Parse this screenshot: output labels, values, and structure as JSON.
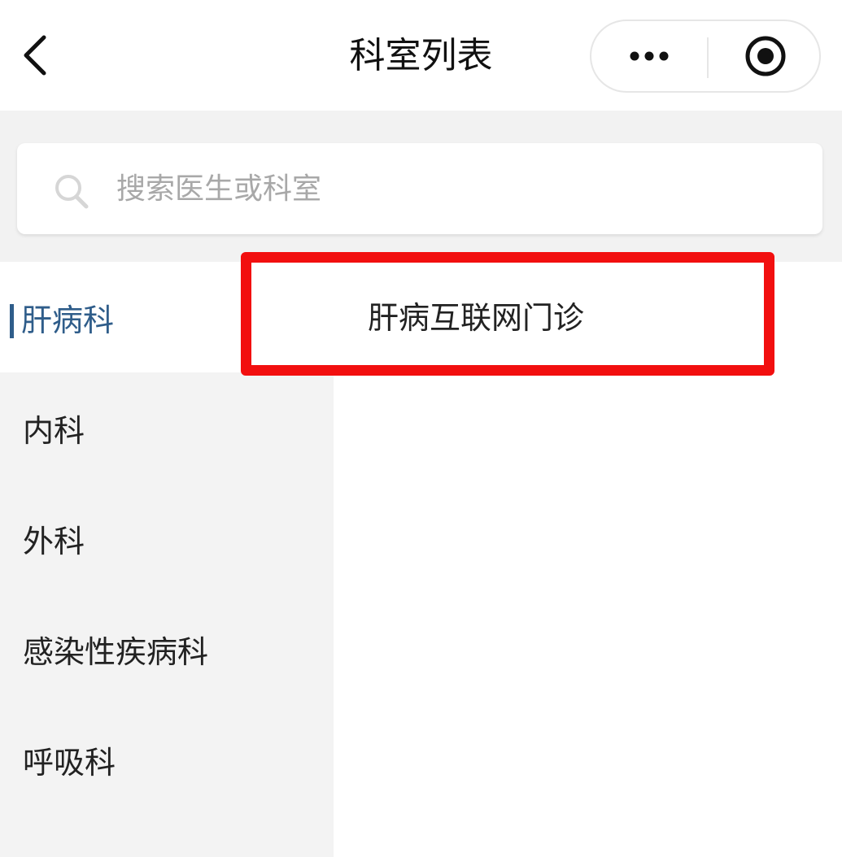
{
  "header": {
    "title": "科室列表",
    "back_icon": "chevron-left-icon",
    "more_icon": "more-dots-icon",
    "close_icon": "target-circle-icon"
  },
  "search": {
    "placeholder": "搜索医生或科室",
    "value": ""
  },
  "sidebar": {
    "items": [
      {
        "label": "肝病科",
        "active": true
      },
      {
        "label": "内科",
        "active": false
      },
      {
        "label": "外科",
        "active": false
      },
      {
        "label": "感染性疾病科",
        "active": false
      },
      {
        "label": "呼吸科",
        "active": false
      }
    ]
  },
  "departments": {
    "items": [
      {
        "label": "肝病互联网门诊"
      }
    ]
  },
  "colors": {
    "accent": "#2f5d8a",
    "highlight": "#f20f0f"
  }
}
